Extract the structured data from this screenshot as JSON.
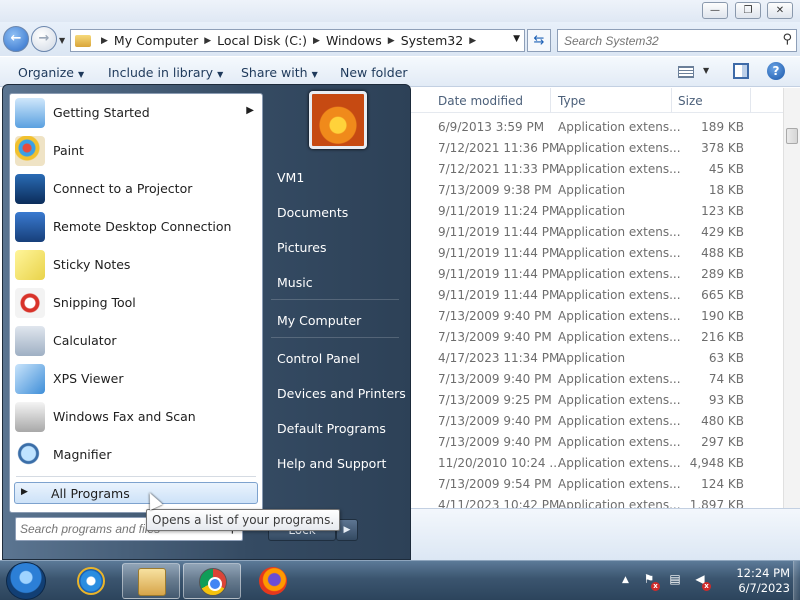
{
  "explorer": {
    "address": [
      "My Computer",
      "Local Disk (C:)",
      "Windows",
      "System32"
    ],
    "search_placeholder": "Search System32",
    "toolbar": {
      "organize": "Organize",
      "include_in_library": "Include in library",
      "share_with": "Share with",
      "new_folder": "New folder"
    },
    "columns": {
      "date": "Date modified",
      "type": "Type",
      "size": "Size"
    },
    "rows": [
      {
        "date": "6/9/2013 3:59 PM",
        "type": "Application extens...",
        "size": "189 KB"
      },
      {
        "date": "7/12/2021 11:36 PM",
        "type": "Application extens...",
        "size": "378 KB"
      },
      {
        "date": "7/12/2021 11:33 PM",
        "type": "Application extens...",
        "size": "45 KB"
      },
      {
        "date": "7/13/2009 9:38 PM",
        "type": "Application",
        "size": "18 KB"
      },
      {
        "date": "9/11/2019 11:24 PM",
        "type": "Application",
        "size": "123 KB"
      },
      {
        "date": "9/11/2019 11:44 PM",
        "type": "Application extens...",
        "size": "429 KB"
      },
      {
        "date": "9/11/2019 11:44 PM",
        "type": "Application extens...",
        "size": "488 KB"
      },
      {
        "date": "9/11/2019 11:44 PM",
        "type": "Application extens...",
        "size": "289 KB"
      },
      {
        "date": "9/11/2019 11:44 PM",
        "type": "Application extens...",
        "size": "665 KB"
      },
      {
        "date": "7/13/2009 9:40 PM",
        "type": "Application extens...",
        "size": "190 KB"
      },
      {
        "date": "7/13/2009 9:40 PM",
        "type": "Application extens...",
        "size": "216 KB"
      },
      {
        "date": "4/17/2023 11:34 PM",
        "type": "Application",
        "size": "63 KB"
      },
      {
        "date": "7/13/2009 9:40 PM",
        "type": "Application extens...",
        "size": "74 KB"
      },
      {
        "date": "7/13/2009 9:25 PM",
        "type": "Application extens...",
        "size": "93 KB"
      },
      {
        "date": "7/13/2009 9:40 PM",
        "type": "Application extens...",
        "size": "480 KB"
      },
      {
        "date": "7/13/2009 9:40 PM",
        "type": "Application extens...",
        "size": "297 KB"
      },
      {
        "date": "11/20/2010 10:24 ...",
        "type": "Application extens...",
        "size": "4,948 KB"
      },
      {
        "date": "7/13/2009 9:54 PM",
        "type": "Application extens...",
        "size": "124 KB"
      },
      {
        "date": "4/11/2023 10:42 PM",
        "type": "Application extens...",
        "size": "1,897 KB"
      }
    ]
  },
  "start_menu": {
    "programs": [
      {
        "label": "Getting Started",
        "icon": "getting-started-icon",
        "has_submenu": true
      },
      {
        "label": "Paint",
        "icon": "paint-icon"
      },
      {
        "label": "Connect to a Projector",
        "icon": "projector-icon"
      },
      {
        "label": "Remote Desktop Connection",
        "icon": "remote-desktop-icon"
      },
      {
        "label": "Sticky Notes",
        "icon": "sticky-notes-icon"
      },
      {
        "label": "Snipping Tool",
        "icon": "snipping-tool-icon"
      },
      {
        "label": "Calculator",
        "icon": "calculator-icon"
      },
      {
        "label": "XPS Viewer",
        "icon": "xps-viewer-icon"
      },
      {
        "label": "Windows Fax and Scan",
        "icon": "fax-scan-icon"
      },
      {
        "label": "Magnifier",
        "icon": "magnifier-icon"
      }
    ],
    "all_programs": "All Programs",
    "search_placeholder": "Search programs and files",
    "right_items": [
      "VM1",
      "Documents",
      "Pictures",
      "Music",
      "My Computer",
      "Control Panel",
      "Devices and Printers",
      "Default Programs",
      "Help and Support"
    ],
    "shutdown_label": "Lock",
    "tooltip": "Opens a list of your programs."
  },
  "taskbar": {
    "time": "12:24 PM",
    "date": "6/7/2023"
  }
}
